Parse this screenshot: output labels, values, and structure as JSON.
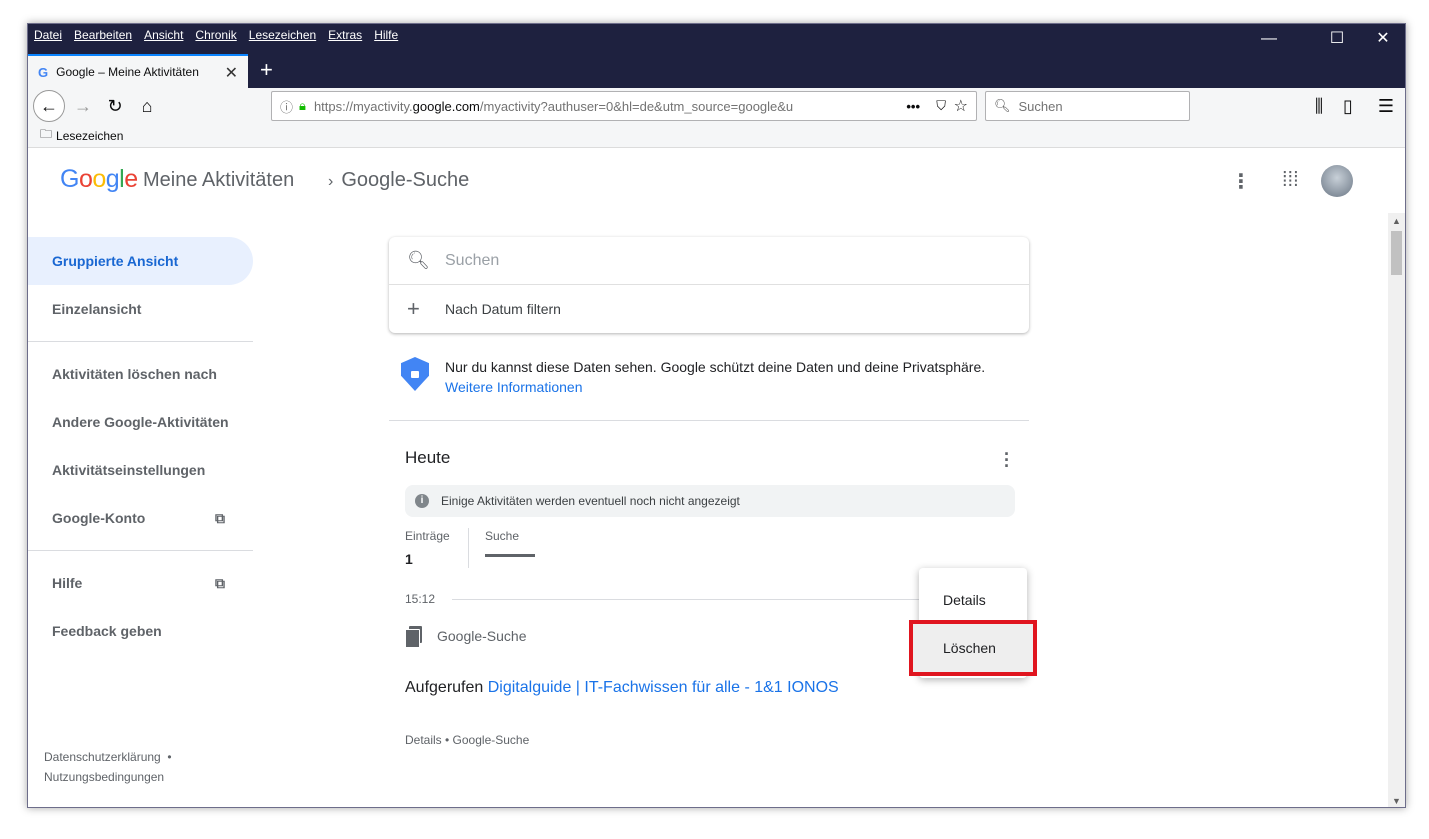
{
  "window": {
    "menu": [
      "Datei",
      "Bearbeiten",
      "Ansicht",
      "Chronik",
      "Lesezeichen",
      "Extras",
      "Hilfe"
    ],
    "tab_title": "Google – Meine Aktivitäten",
    "url_prefix": "https://myactivity.",
    "url_host": "google.com",
    "url_rest": "/myactivity?authuser=0&hl=de&utm_source=google&u",
    "search_placeholder": "Suchen",
    "bookmarks_label": "Lesezeichen"
  },
  "header": {
    "logo": "Google",
    "app_title": "Meine Aktivitäten",
    "breadcrumb": "Google-Suche"
  },
  "sidebar": {
    "items": [
      "Gruppierte Ansicht",
      "Einzelansicht",
      "Aktivitäten löschen nach",
      "Andere Google-Aktivitäten",
      "Aktivitätseinstellungen",
      "Google-Konto",
      "Hilfe",
      "Feedback geben"
    ],
    "footer": [
      "Datenschutzerklärung",
      "Nutzungsbedingungen"
    ]
  },
  "main": {
    "search_placeholder": "Suchen",
    "filter_label": "Nach Datum filtern",
    "privacy_text": "Nur du kannst diese Daten sehen. Google schützt deine Daten und deine Privatsphäre.",
    "privacy_link": "Weitere Informationen",
    "section_title": "Heute",
    "info_text": "Einige Aktivitäten werden eventuell noch nicht angezeigt",
    "entries_label": "Einträge",
    "entries_value": "1",
    "tab_label": "Suche",
    "time": "15:12",
    "entry_product": "Google-Suche",
    "visited_prefix": "Aufgerufen",
    "visited_link": "Digitalguide | IT-Fachwissen für alle - 1&1 IONOS",
    "details_line": "Details • Google-Suche"
  },
  "menu": {
    "details": "Details",
    "delete": "Löschen"
  }
}
